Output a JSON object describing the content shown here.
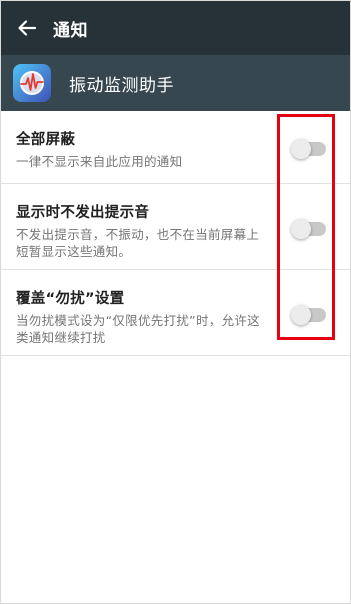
{
  "appbar": {
    "back_icon": "arrow-left-icon",
    "title": "通知"
  },
  "app": {
    "icon": "heartbeat-monitor-icon",
    "name": "振动监测助手"
  },
  "settings": [
    {
      "title": "全部屏蔽",
      "description": "一律不显示来自此应用的通知",
      "enabled": false
    },
    {
      "title": "显示时不发出提示音",
      "description": "不发出提示音，不振动，也不在当前屏幕上短暂显示这些通知。",
      "enabled": false
    },
    {
      "title": "覆盖“勿扰”设置",
      "description": "当勿扰模式设为“仅限优先打扰”时，允许这类通知继续打扰",
      "enabled": false
    }
  ],
  "colors": {
    "appbar": "#263238",
    "app_header": "#37474f",
    "highlight": "#e60012",
    "toggle_off_track": "#c8c8c8",
    "toggle_off_knob": "#ececec"
  }
}
